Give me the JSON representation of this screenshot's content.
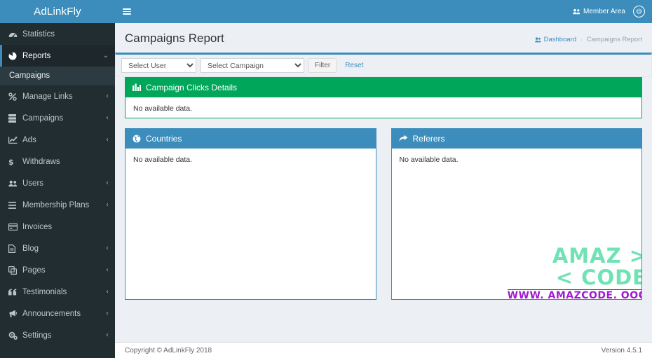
{
  "brand": {
    "name": "AdLinkFly"
  },
  "header": {
    "hamburger_icon": "hamburger-menu-icon",
    "member_area_label": "Member Area",
    "member_area_icon": "users-icon",
    "power_icon": "power-off-icon",
    "power_glyph": "⏻"
  },
  "sidebar": {
    "items": [
      {
        "label": "Statistics",
        "icon": "tachometer-icon",
        "glyph": "⛭",
        "caret": "",
        "active": false,
        "has_sub": false
      },
      {
        "label": "Reports",
        "icon": "pie-chart-icon",
        "glyph": "◔",
        "caret": "⌄",
        "active": true,
        "has_sub": true
      },
      {
        "label": "Manage Links",
        "icon": "link-chain-icon",
        "glyph": "%",
        "caret": "‹",
        "active": false,
        "has_sub": false
      },
      {
        "label": "Campaigns",
        "icon": "server-stack-icon",
        "glyph": "☰",
        "caret": "‹",
        "active": false,
        "has_sub": false
      },
      {
        "label": "Ads",
        "icon": "line-chart-icon",
        "glyph": "↗",
        "caret": "‹",
        "active": false,
        "has_sub": false
      },
      {
        "label": "Withdraws",
        "icon": "dollar-sign-icon",
        "glyph": "$",
        "caret": "",
        "active": false,
        "has_sub": false
      },
      {
        "label": "Users",
        "icon": "users-group-icon",
        "glyph": "⛭",
        "caret": "‹",
        "active": false,
        "has_sub": false
      },
      {
        "label": "Membership Plans",
        "icon": "list-bars-icon",
        "glyph": "☰",
        "caret": "‹",
        "active": false,
        "has_sub": false
      },
      {
        "label": "Invoices",
        "icon": "credit-card-icon",
        "glyph": "▤",
        "caret": "",
        "active": false,
        "has_sub": false
      },
      {
        "label": "Blog",
        "icon": "file-document-icon",
        "glyph": "὜B",
        "caret": "‹",
        "active": false,
        "has_sub": false
      },
      {
        "label": "Pages",
        "icon": "clone-pages-icon",
        "glyph": "⧉",
        "caret": "‹",
        "active": false,
        "has_sub": false
      },
      {
        "label": "Testimonials",
        "icon": "quote-left-icon",
        "glyph": "“",
        "caret": "‹",
        "active": false,
        "has_sub": false
      },
      {
        "label": "Announcements",
        "icon": "bullhorn-icon",
        "glyph": "὎3",
        "caret": "‹",
        "active": false,
        "has_sub": false
      },
      {
        "label": "Settings",
        "icon": "gears-icon",
        "glyph": "⚙",
        "caret": "‹",
        "active": false,
        "has_sub": false
      }
    ],
    "sub_item": {
      "label": "Campaigns"
    }
  },
  "page": {
    "title": "Campaigns Report",
    "breadcrumb": {
      "home_label": "Dashboard",
      "home_icon": "dashboard-icon",
      "separator": "›",
      "current_label": "Campaigns Report"
    }
  },
  "filter": {
    "user_select": {
      "selected": "Select User",
      "options": [
        "Select User"
      ]
    },
    "campaign_select": {
      "selected": "Select Campaign",
      "options": [
        "Select Campaign"
      ]
    },
    "filter_button": "Filter",
    "reset_link": "Reset"
  },
  "panels": {
    "clicks": {
      "title": "Campaign Clicks Details",
      "icon": "bar-chart-icon",
      "glyph": "█",
      "body_text": "No available data.",
      "color": "#00a65a"
    },
    "countries": {
      "title": "Countries",
      "icon": "globe-icon",
      "glyph": "ἱ0",
      "body_text": "No available data.",
      "color": "#3c8dbc"
    },
    "referers": {
      "title": "Referers",
      "icon": "share-arrow-icon",
      "glyph": "➦",
      "body_text": "No available data.",
      "color": "#3c8dbc"
    }
  },
  "watermark": {
    "line1": "AMAZ >",
    "line2": "< CODE",
    "url": "WWW. AMAZCODE. OOO",
    "color_text": "#6fe3b4",
    "color_url": "#a01bd0"
  },
  "footer": {
    "copyright": "Copyright © AdLinkFly 2018",
    "version": "Version 4.5.1"
  }
}
